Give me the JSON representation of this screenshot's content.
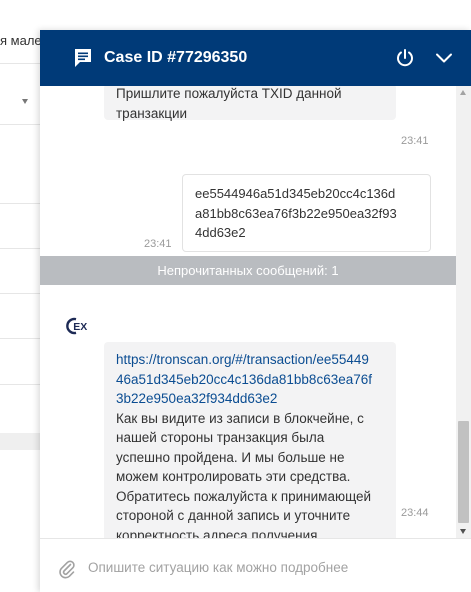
{
  "background_page": {
    "visible_text": "я мале"
  },
  "header": {
    "title": "Case ID #77296350",
    "color": "#003a78"
  },
  "messages": [
    {
      "direction": "incoming",
      "text_lines": [
        "Пришлите пожалуйста TXID данной",
        "транзакции"
      ],
      "time": "23:41"
    },
    {
      "direction": "outgoing",
      "text_lines": [
        "ee5544946a51d345eb20cc4c136d",
        "a81bb8c63ea76f3b22e950ea32f93",
        "4dd63e2"
      ],
      "time": "23:41"
    },
    {
      "direction": "incoming",
      "link_lines": [
        "https://tronscan.org/#/transaction/ee55449",
        "46a51d345eb20cc4c136da81bb8c63ea76f",
        "3b22e950ea32f934dd63e2"
      ],
      "text_lines": [
        "Как вы видите из записи в блокчейне, с",
        "нашей стороны транзакция была",
        "успешно пройдена. И мы больше не",
        "можем контролировать эти средства.",
        "Обратитесь пожалуйста к принимающей",
        "стороной с данной запись и уточните",
        "корректность адреса получения"
      ],
      "time": "23:44"
    }
  ],
  "unread_separator": "Непрочитанных сообщений: 1",
  "input": {
    "placeholder": "Опишите ситуацию как можно подробнее",
    "value": ""
  },
  "icons": {
    "header_chat": "chat-bubble-icon",
    "power": "power-icon",
    "collapse": "chevron-down-icon",
    "agent_logo": "cex-logo-icon",
    "attach": "paperclip-icon"
  }
}
